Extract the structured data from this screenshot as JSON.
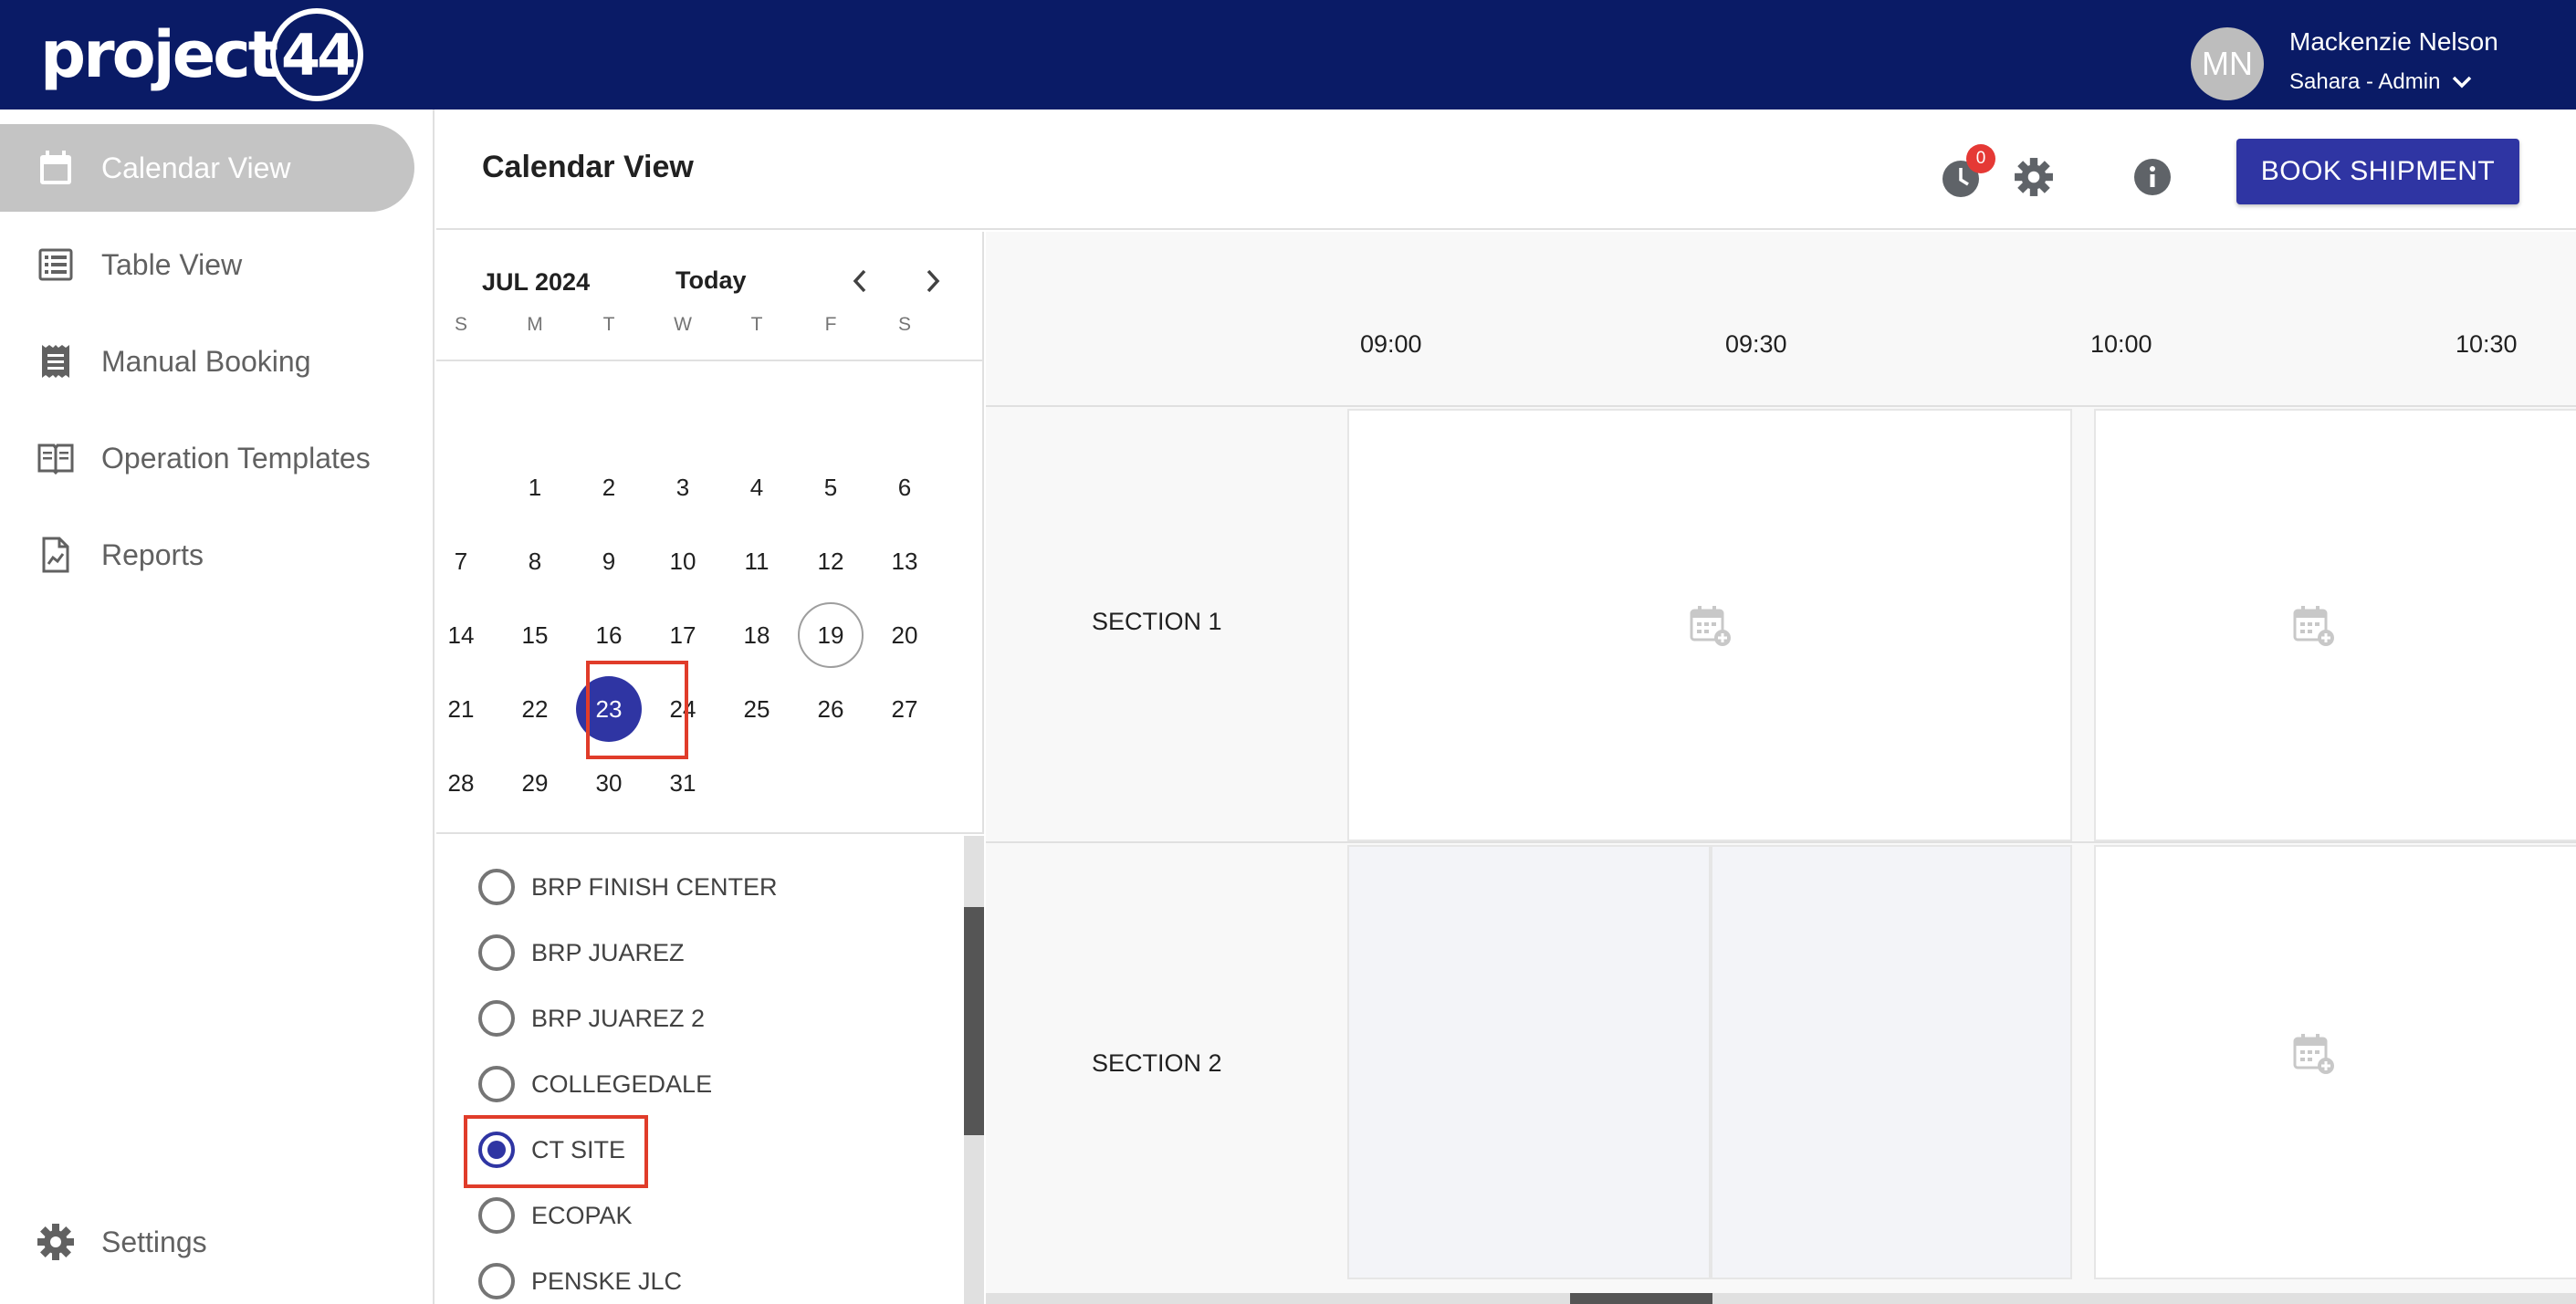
{
  "brand": {
    "logo_text": "project",
    "logo_badge": "44"
  },
  "user": {
    "initials": "MN",
    "name": "Mackenzie Nelson",
    "role": "Sahara - Admin"
  },
  "sidebar": {
    "items": [
      {
        "label": "Calendar View",
        "icon": "calendar-icon",
        "active": true
      },
      {
        "label": "Table View",
        "icon": "list-icon"
      },
      {
        "label": "Manual Booking",
        "icon": "receipt-icon"
      },
      {
        "label": "Operation Templates",
        "icon": "book-icon"
      },
      {
        "label": "Reports",
        "icon": "report-icon"
      }
    ],
    "settings_label": "Settings"
  },
  "header": {
    "title": "Calendar View",
    "notification_count": "0",
    "book_button": "BOOK SHIPMENT"
  },
  "calendar": {
    "month_label": "JUL 2024",
    "today_label": "Today",
    "weekdays": [
      "S",
      "M",
      "T",
      "W",
      "T",
      "F",
      "S"
    ],
    "today": 19,
    "selected": 23,
    "weeks": [
      [
        "",
        "1",
        "2",
        "3",
        "4",
        "5",
        "6"
      ],
      [
        "7",
        "8",
        "9",
        "10",
        "11",
        "12",
        "13"
      ],
      [
        "14",
        "15",
        "16",
        "17",
        "18",
        "19",
        "20"
      ],
      [
        "21",
        "22",
        "23",
        "24",
        "25",
        "26",
        "27"
      ],
      [
        "28",
        "29",
        "30",
        "31",
        "",
        "",
        ""
      ]
    ]
  },
  "sites": {
    "items": [
      {
        "label": "BRP FINISH CENTER",
        "checked": false
      },
      {
        "label": "BRP JUAREZ",
        "checked": false
      },
      {
        "label": "BRP JUAREZ 2",
        "checked": false
      },
      {
        "label": "COLLEGEDALE",
        "checked": false
      },
      {
        "label": "CT SITE",
        "checked": true
      },
      {
        "label": "ECOPAK",
        "checked": false
      },
      {
        "label": "PENSKE JLC",
        "checked": false
      }
    ]
  },
  "timeline": {
    "times": [
      "09:00",
      "09:30",
      "10:00",
      "10:30"
    ],
    "sections": [
      "SECTION 1",
      "SECTION 2"
    ]
  },
  "colors": {
    "topbar": "#0a1b66",
    "primary": "#2f35a3",
    "highlight": "#e03c2a",
    "badge": "#e53935"
  }
}
